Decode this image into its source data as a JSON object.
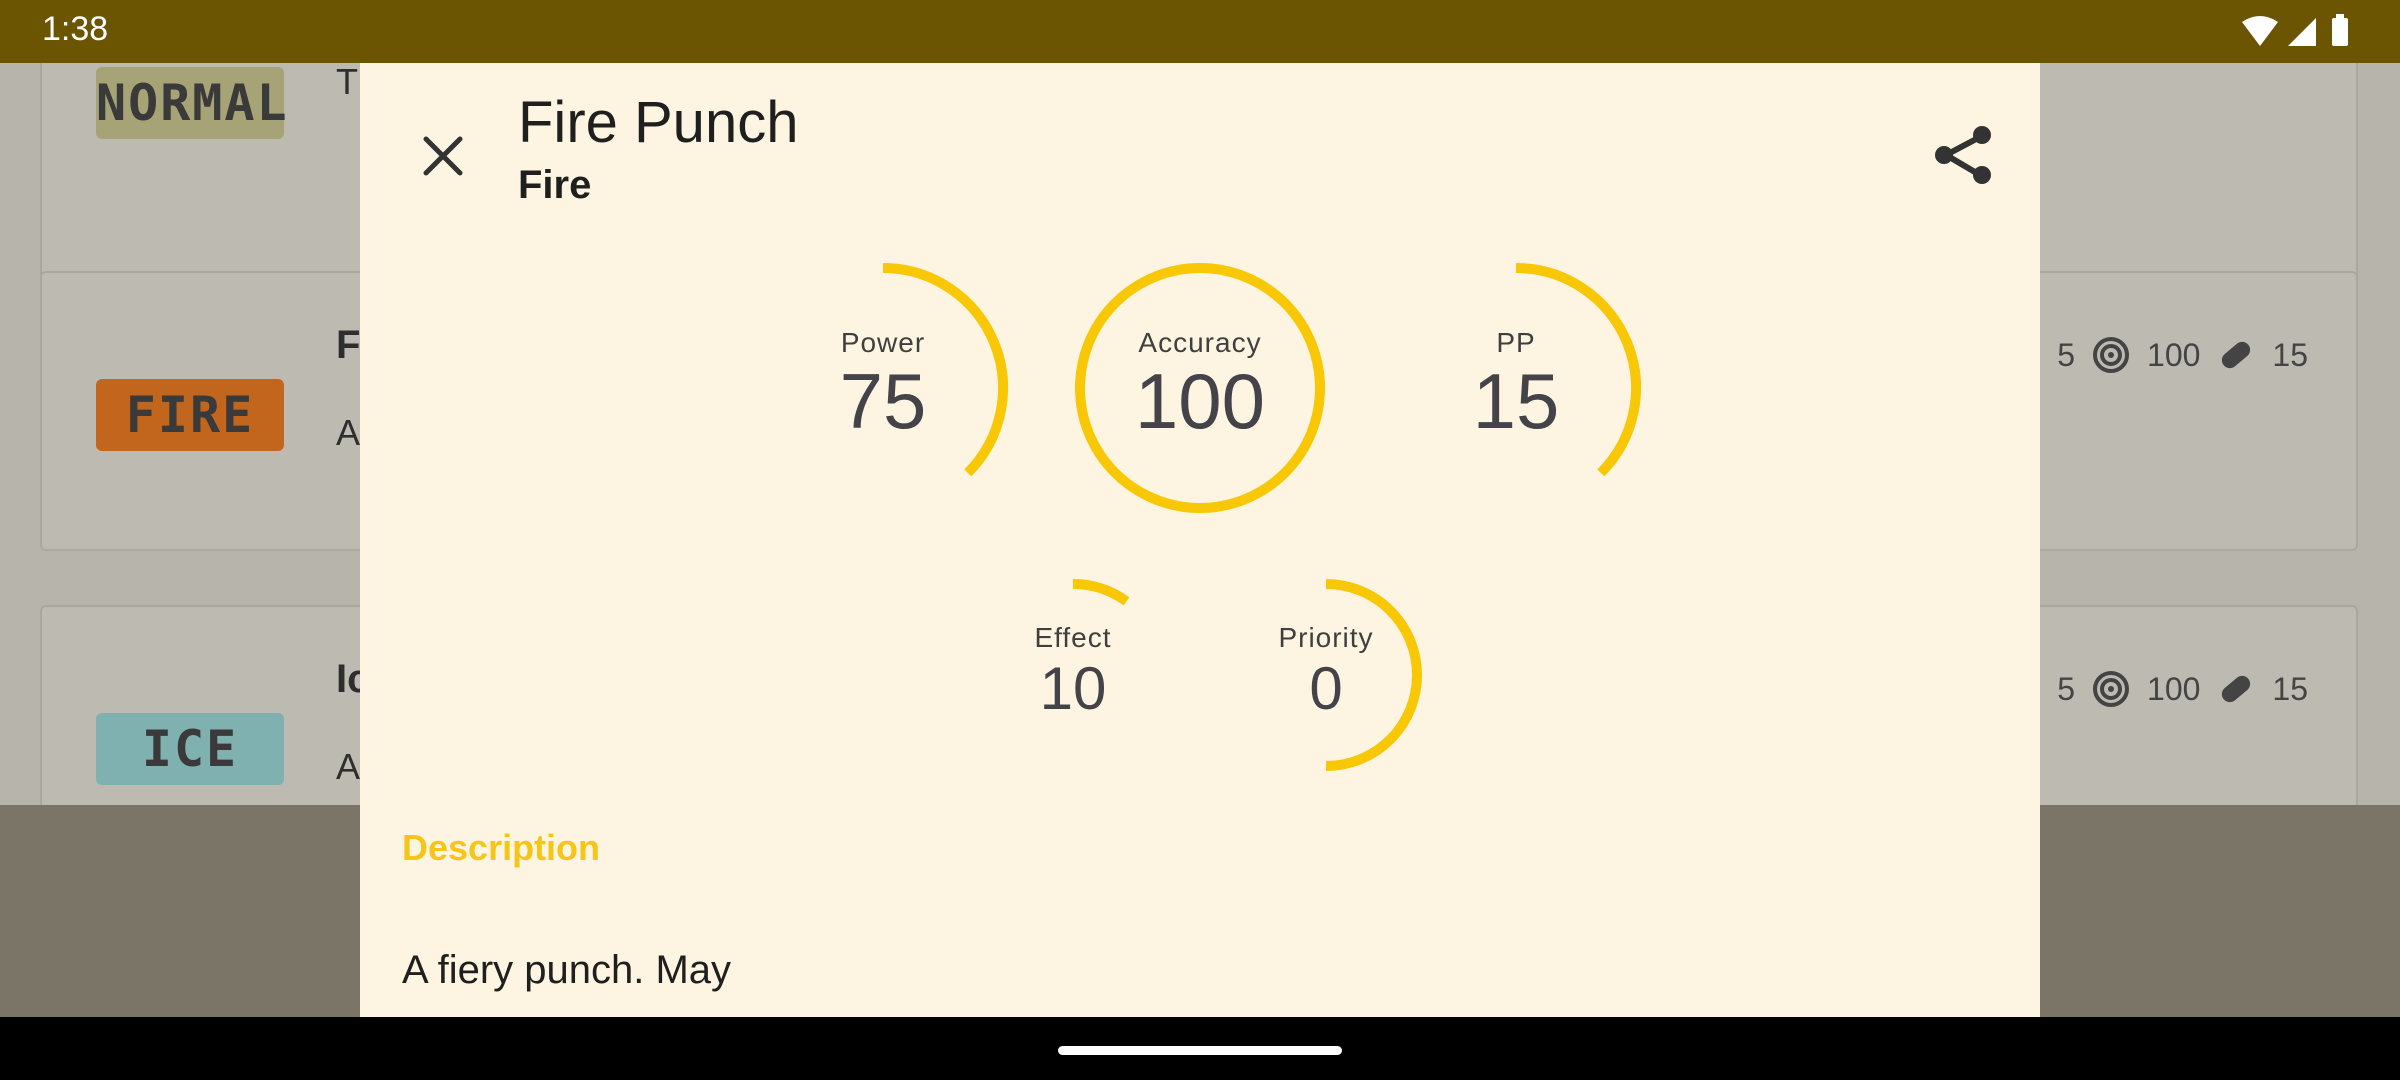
{
  "status_bar": {
    "time": "1:38"
  },
  "background_list": [
    {
      "badge": "NORMAL",
      "badge_color": "#a6a377",
      "name": "",
      "desc": "T\nth",
      "stats": []
    },
    {
      "badge": "FIRE",
      "badge_color": "#c2661e",
      "name": "F",
      "desc": "A\nca",
      "stats": [
        "5",
        "100",
        "15"
      ]
    },
    {
      "badge": "ICE",
      "badge_color": "#7fb1b0",
      "name": "Ic",
      "desc": "A",
      "stats": [
        "5",
        "100",
        "15"
      ]
    }
  ],
  "dialog": {
    "title": "Fire Punch",
    "subtitle": "Fire",
    "close_icon": "close-icon",
    "share_icon": "share-icon",
    "gauges": [
      {
        "label": "Power",
        "value": "75",
        "fraction": 0.375
      },
      {
        "label": "Accuracy",
        "value": "100",
        "fraction": 1.0
      },
      {
        "label": "PP",
        "value": "15",
        "fraction": 0.375
      },
      {
        "label": "Effect",
        "value": "10",
        "fraction": 0.1
      },
      {
        "label": "Priority",
        "value": "0",
        "fraction": 0.5
      }
    ],
    "description_title": "Description",
    "description": "A fiery punch. May"
  },
  "colors": {
    "accent": "#f8c706",
    "dialog_bg": "#fdf5e2",
    "status_bar": "#6b5502"
  }
}
